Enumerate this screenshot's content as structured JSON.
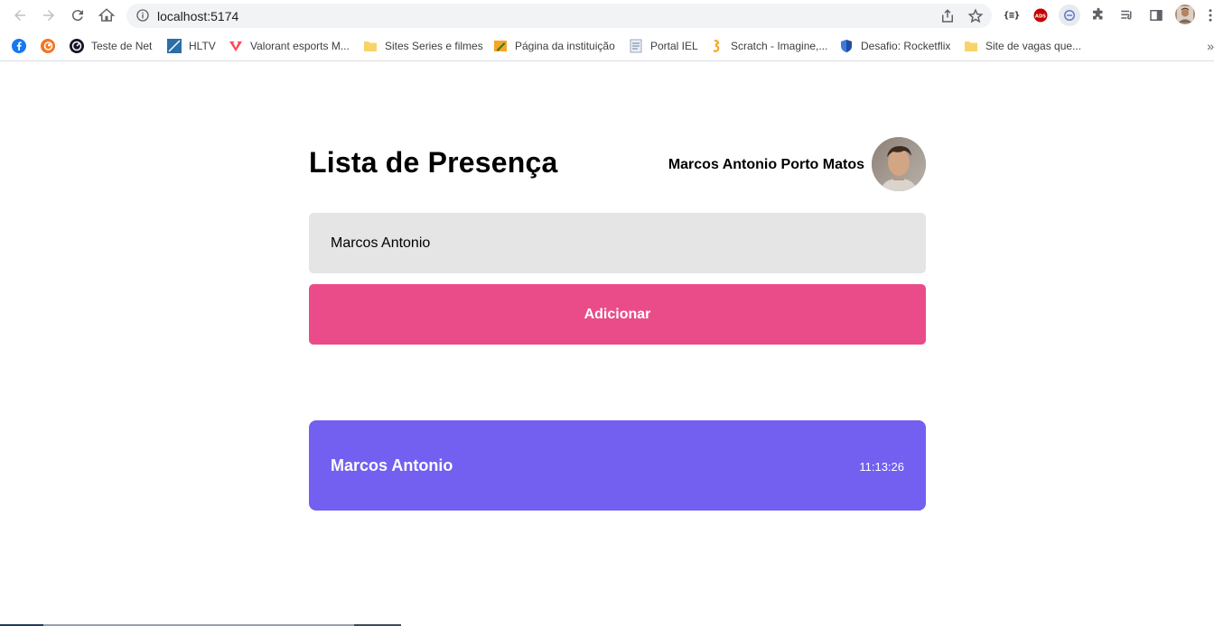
{
  "browser": {
    "url": "localhost:5174",
    "bookmarks": [
      {
        "label": "",
        "icon": "facebook-icon"
      },
      {
        "label": "",
        "icon": "crunchyroll-icon"
      },
      {
        "label": "Teste de Net",
        "icon": "speedtest-icon"
      },
      {
        "label": "HLTV",
        "icon": "hltv-icon"
      },
      {
        "label": "Valorant esports M...",
        "icon": "valorant-icon"
      },
      {
        "label": "Sites Series e filmes",
        "icon": "folder-icon"
      },
      {
        "label": "Página da instituição",
        "icon": "pencil-page-icon"
      },
      {
        "label": "Portal IEL",
        "icon": "document-icon"
      },
      {
        "label": "Scratch - Imagine,...",
        "icon": "scratch-icon"
      },
      {
        "label": "Desafio: Rocketflix",
        "icon": "shield-icon"
      },
      {
        "label": "Site de vagas que...",
        "icon": "folder-icon"
      }
    ],
    "more_label": "»"
  },
  "app": {
    "title": "Lista de Presença",
    "user_name": "Marcos Antonio Porto Matos",
    "input_value": "Marcos Antonio",
    "button_label": "Adicionar",
    "cards": [
      {
        "name": "Marcos Antonio",
        "time": "11:13:26"
      }
    ]
  },
  "colors": {
    "button": "#ea4c89",
    "card": "#735ff0",
    "input_bg": "#e5e5e5"
  }
}
